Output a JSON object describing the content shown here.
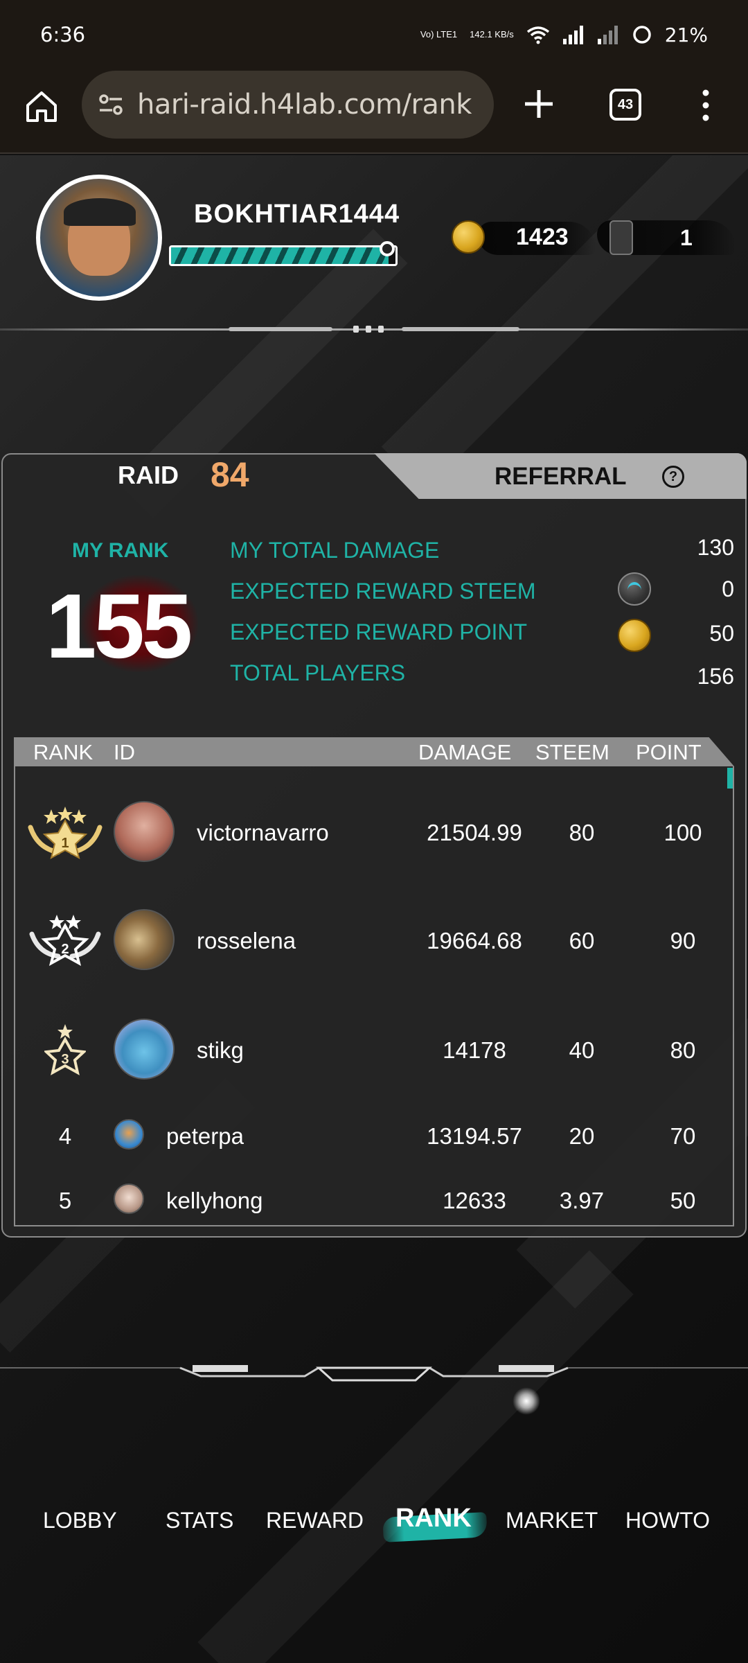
{
  "status_bar": {
    "time": "6:36",
    "network_type": "Vo) LTE1",
    "speed": "142.1 KB/s",
    "battery": "21%"
  },
  "browser": {
    "url": "hari-raid.h4lab.com/rank",
    "tab_count": "43"
  },
  "profile": {
    "username": "BOKHTIAR1444",
    "xp_fraction": 0.97,
    "points": "1423",
    "tickets": "1"
  },
  "tabs": {
    "raid_label": "RAID",
    "raid_number": "84",
    "referral_label": "REFERRAL",
    "help_symbol": "?"
  },
  "my_rank": {
    "label": "MY RANK",
    "value": "155"
  },
  "stats": [
    {
      "label": "MY TOTAL DAMAGE",
      "value": "130"
    },
    {
      "label": "EXPECTED REWARD STEEM",
      "value": "0"
    },
    {
      "label": "EXPECTED REWARD POINT",
      "value": "50"
    },
    {
      "label": "TOTAL PLAYERS",
      "value": "156"
    }
  ],
  "table": {
    "headers": {
      "rank": "RANK",
      "id": "ID",
      "damage": "DAMAGE",
      "steem": "STEEM",
      "point": "POINT"
    },
    "rows": [
      {
        "rank": "1",
        "name": "victornavarro",
        "damage": "21504.99",
        "steem": "80",
        "point": "100"
      },
      {
        "rank": "2",
        "name": "rosselena",
        "damage": "19664.68",
        "steem": "60",
        "point": "90"
      },
      {
        "rank": "3",
        "name": "stikg",
        "damage": "14178",
        "steem": "40",
        "point": "80"
      },
      {
        "rank": "4",
        "name": "peterpa",
        "damage": "13194.57",
        "steem": "20",
        "point": "70"
      },
      {
        "rank": "5",
        "name": "kellyhong",
        "damage": "12633",
        "steem": "3.97",
        "point": "50"
      }
    ]
  },
  "nav": {
    "lobby": "LOBBY",
    "stats": "STATS",
    "reward": "REWARD",
    "rank": "RANK",
    "market": "MARKET",
    "howto": "HOWTO"
  },
  "colors": {
    "accent_teal": "#1fb3a6",
    "raid_number_orange": "#f0a86a",
    "browser_bar": "#1d1813",
    "url_box": "#3a342c"
  },
  "icons": {
    "home": "home-icon",
    "tune": "site-settings-icon",
    "plus": "new-tab-icon",
    "menu": "more-vert-icon",
    "coin": "point-coin-icon",
    "ticket": "ticket-icon",
    "steem": "steem-icon",
    "help": "help-icon"
  }
}
